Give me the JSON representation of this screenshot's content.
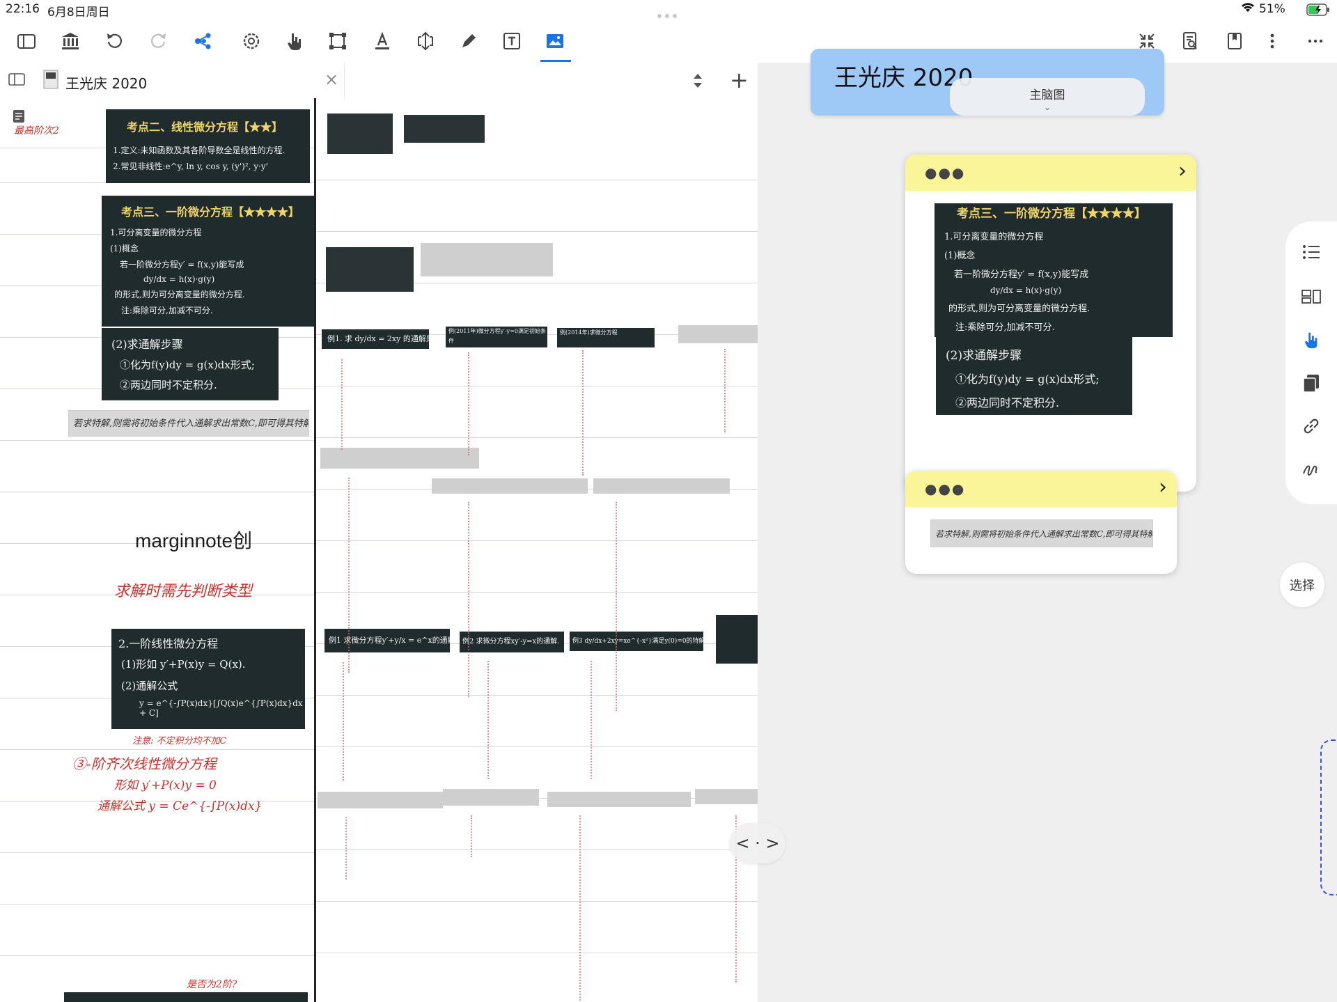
{
  "status": {
    "time": "22:16",
    "date": "6月8日周日",
    "battery": "51%"
  },
  "toolbar": {
    "left_icons": [
      "sidebar-icon",
      "library-icon",
      "undo-icon",
      "redo-icon",
      "mindmap-share-icon",
      "settings-gear-icon",
      "hand-pointer-icon",
      "select-frame-icon",
      "text-highlight-icon",
      "resize-arrows-icon",
      "pen-icon",
      "textbox-icon",
      "image-capture-icon"
    ],
    "right_icons": [
      "collapse-icon",
      "search-doc-icon",
      "bookmark-icon",
      "more-vertical-icon",
      "more-horizontal-icon"
    ],
    "active": "image-capture-icon"
  },
  "document": {
    "tab_title": "王光庆 2020",
    "close_glyph": "×",
    "add_glyph": "+",
    "center_text": "marginnote创",
    "block1": {
      "title": "考点二、线性微分方程【★★】",
      "lines": [
        "1.定义:未知函数及其各阶导数全是线性的方程.",
        "2.常见非线性:e^y, ln y, cos y, (y')², y·y'"
      ]
    },
    "block2": {
      "title": "考点三、一阶微分方程【★★★★】",
      "lines": [
        "1.可分离变量的微分方程",
        "(1)概念",
        "若一阶微分方程y′ = f(x,y)能写成",
        "dy/dx = h(x)·g(y)",
        "的形式,则为可分离变量的微分方程.",
        "注:乘除可分,加减不可分."
      ]
    },
    "block3": {
      "title": "(2)求通解步骤",
      "lines": [
        "①化为f(y)dy = g(x)dx形式;",
        "②两边同时不定积分."
      ]
    },
    "gray_note": "若求特解,则需将初始条件代入通解求出常数C,即可得其特解.",
    "block4": {
      "title": "2.一阶线性微分方程",
      "lines": [
        "(1)形如  y′+P(x)y = Q(x).",
        "(2)通解公式",
        "y = e^{-∫P(x)dx}[∫Q(x)e^{∫P(x)dx}dx + C]"
      ]
    },
    "hand_notes": [
      "求解时需先判断类型",
      "③-阶齐次线性微分方程",
      "形如 y′+P(x)y = 0",
      "通解公式 y = Ce^{-∫P(x)dx}",
      "注意: 不定积分均不加C",
      "最高阶次2",
      "是否为2阶?"
    ],
    "examples": [
      "例1. 求 dy/dx = 2xy 的通解是",
      "例(2011年)微分方程y′-y=0满足初始条件",
      "例(2014年)求微分方程",
      "例1 求微分方程y′+y/x = e^x的通解.",
      "例2 求微分方程xy′-y=x的通解.",
      "例3 dy/dx+2xy=xe^{-x²}满足y(0)=0的特解是"
    ]
  },
  "mindmap": {
    "root_title": "王光庆 2020",
    "tab_label": "主脑图",
    "card1": {
      "title": "考点三、一阶微分方程【★★★★】",
      "lines": [
        "1.可分离变量的微分方程",
        "(1)概念",
        "若一阶微分方程y′ = f(x,y)能写成",
        "dy/dx = h(x)·g(y)",
        "的形式,则为可分离变量的微分方程.",
        "注:乘除可分,加减不可分."
      ],
      "step_title": "(2)求通解步骤",
      "steps": [
        "①化为f(y)dy = g(x)dx形式;",
        "②两边同时不定积分."
      ]
    },
    "card2": {
      "text": "若求特解,则需将初始条件代入通解求出常数C,即可得其特解."
    },
    "select_label": "选择",
    "nav_glyph": "< · >",
    "side_icons": [
      "outline-list-icon",
      "layout-icon",
      "hand-pointer-icon",
      "copy-icon",
      "link-icon",
      "handwriting-icon"
    ]
  }
}
